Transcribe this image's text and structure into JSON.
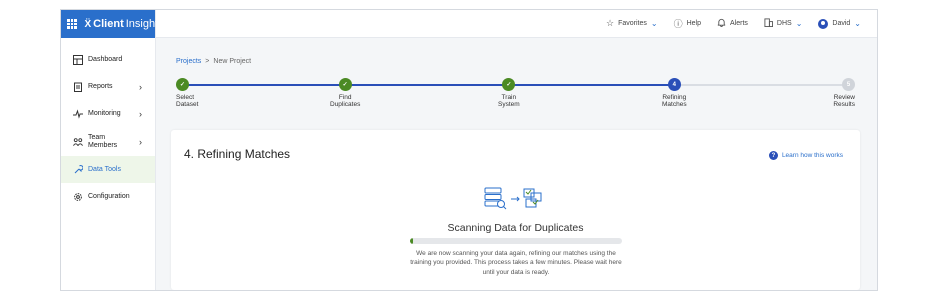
{
  "brand": {
    "name_bold": "Client",
    "name_light": "Insight"
  },
  "sidebar": {
    "items": [
      {
        "label": "Dashboard",
        "icon": "dashboard-icon"
      },
      {
        "label": "Reports",
        "icon": "report-icon"
      },
      {
        "label": "Monitoring",
        "icon": "pulse-icon"
      },
      {
        "label_line1": "Team",
        "label_line2": "Members",
        "icon": "team-icon"
      },
      {
        "label": "Data Tools",
        "icon": "data-tools-icon",
        "active": true
      },
      {
        "label": "Configuration",
        "icon": "gear-icon"
      }
    ]
  },
  "topbar": {
    "favorites": "Favorites",
    "help": "Help",
    "alerts": "Alerts",
    "org": "DHS",
    "user": "David"
  },
  "breadcrumb": {
    "parent": "Projects",
    "separator": ">",
    "current": "New Project"
  },
  "stepper": {
    "steps": [
      {
        "line1": "Select",
        "line2": "Dataset",
        "state": "done"
      },
      {
        "line1": "Find",
        "line2": "Duplicates",
        "state": "done"
      },
      {
        "line1": "Train",
        "line2": "System",
        "state": "done"
      },
      {
        "line1": "Refining",
        "line2": "Matches",
        "state": "current",
        "number": "4"
      },
      {
        "line1": "Review",
        "line2": "Results",
        "state": "todo",
        "number": "5"
      }
    ]
  },
  "card": {
    "title": "4. Refining Matches",
    "learn_link": "Learn how this works",
    "scan_title": "Scanning Data for Duplicates",
    "progress_fraction": 0.01,
    "description": "We are now scanning your data again, refining our matches using the training you provided. This process takes a few minutes. Please wait here until your data is ready."
  },
  "colors": {
    "brand_blue": "#2a6fcb",
    "success_green": "#4b8a24",
    "step_blue": "#2a4fb8"
  }
}
